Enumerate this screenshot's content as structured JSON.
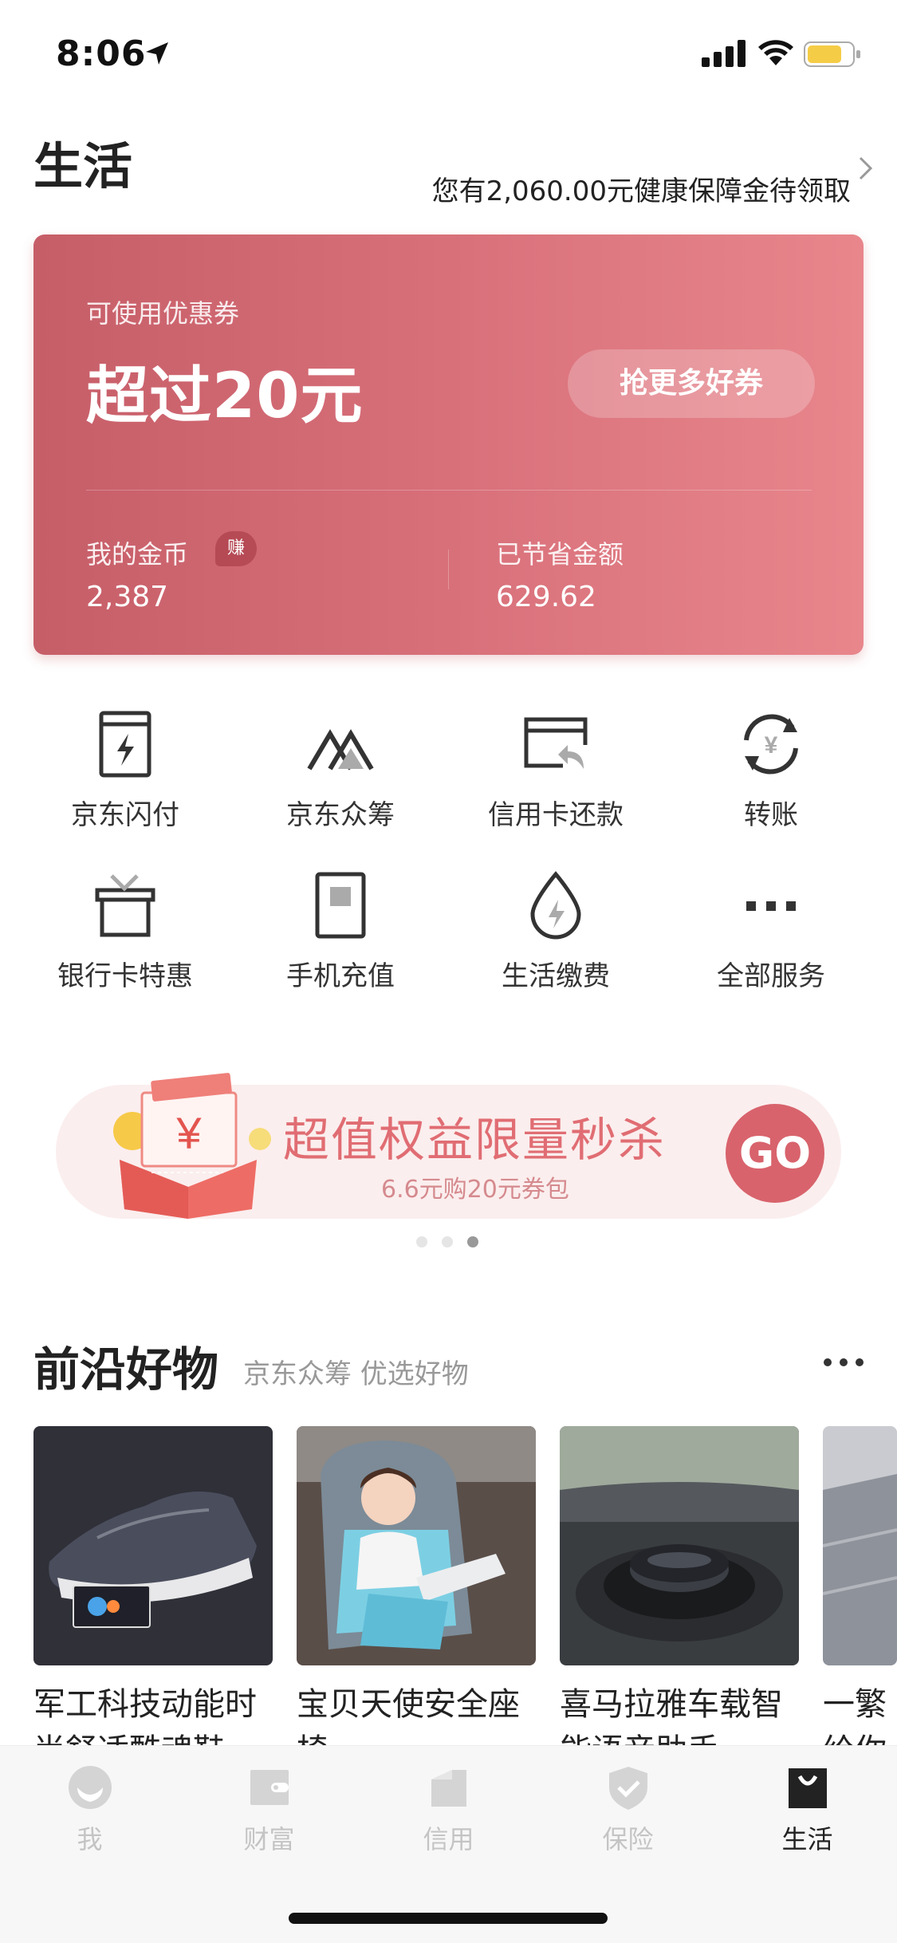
{
  "status_bar": {
    "time": "8:06"
  },
  "header": {
    "title": "生活",
    "health_notice": "您有2,060.00元健康保障金待领取"
  },
  "coupon_card": {
    "label": "可使用优惠券",
    "amount": "超过20元",
    "button_label": "抢更多好券",
    "coins_label": "我的金币",
    "earn_badge": "赚",
    "coins_value": "2,387",
    "saved_label": "已节省金额",
    "saved_value": "629.62"
  },
  "services": [
    {
      "label": "京东闪付",
      "icon": "jd-flash-pay-icon"
    },
    {
      "label": "京东众筹",
      "icon": "jd-crowdfunding-icon"
    },
    {
      "label": "信用卡还款",
      "icon": "credit-card-repay-icon"
    },
    {
      "label": "转账",
      "icon": "transfer-icon"
    },
    {
      "label": "银行卡特惠",
      "icon": "gift-box-icon"
    },
    {
      "label": "手机充值",
      "icon": "phone-topup-icon"
    },
    {
      "label": "生活缴费",
      "icon": "utility-payment-icon"
    },
    {
      "label": "全部服务",
      "icon": "more-dots-icon"
    }
  ],
  "promo_banner": {
    "title": "超值权益限量秒杀",
    "subtitle": "6.6元购20元券包",
    "go_label": "GO",
    "gift_symbol": "¥",
    "pages": 3,
    "active_page": 3
  },
  "section": {
    "title": "前沿好物",
    "subtitle": "京东众筹 优选好物"
  },
  "products": [
    {
      "title_line1": "军工科技动能时",
      "title_line2": "尚舒适酷魂鞋"
    },
    {
      "title_line1": "宝贝天使安全座",
      "title_line2": "椅"
    },
    {
      "title_line1": "喜马拉雅车载智",
      "title_line2": "能语音助手"
    },
    {
      "title_line1": "一繁",
      "title_line2": "给你"
    }
  ],
  "tabbar": {
    "tabs": [
      {
        "label": "我",
        "icon": "profile-icon",
        "active": false
      },
      {
        "label": "财富",
        "icon": "wallet-icon",
        "active": false
      },
      {
        "label": "信用",
        "icon": "credit-icon",
        "active": false
      },
      {
        "label": "保险",
        "icon": "shield-icon",
        "active": false
      },
      {
        "label": "生活",
        "icon": "shopping-bag-icon",
        "active": true
      }
    ]
  },
  "colors": {
    "card_gradient_start": "#c65e68",
    "card_gradient_end": "#e8868c",
    "promo_accent": "#d8636c",
    "tab_inactive": "#c4c4c4",
    "tab_active": "#222222"
  }
}
